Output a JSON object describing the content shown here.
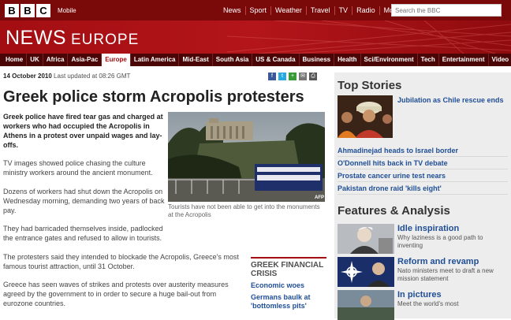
{
  "header": {
    "logo_letters": [
      "B",
      "B",
      "C"
    ],
    "mobile_label": "Mobile",
    "nav": [
      "News",
      "Sport",
      "Weather",
      "Travel",
      "TV",
      "Radio",
      "More ▾"
    ],
    "search_placeholder": "Search the BBC"
  },
  "masthead": {
    "title": "NEWS",
    "section": "EUROPE"
  },
  "sections": [
    "Home",
    "UK",
    "Africa",
    "Asia-Pac",
    "Europe",
    "Latin America",
    "Mid-East",
    "South Asia",
    "US & Canada",
    "Business",
    "Health",
    "Sci/Environment",
    "Tech",
    "Entertainment",
    "Video"
  ],
  "active_section": "Europe",
  "article": {
    "date": "14 October 2010",
    "updated": "Last updated at 08:26 GMT",
    "headline": "Greek police storm Acropolis protesters",
    "intro": "Greek police have fired tear gas and charged at workers who had occupied the Acropolis in Athens in a protest over unpaid wages and lay-offs.",
    "p1": "TV images showed police chasing the culture ministry workers around the ancient monument.",
    "p2": "Dozens of workers had shut down the Acropolis on Wednesday morning, demanding two years of back pay.",
    "p3": "They had barricaded themselves inside, padlocked the entrance gates and refused to allow in tourists.",
    "p4": "The protesters said they intended to blockade the Acropolis, Greece's most famous tourist attraction, until 31 October.",
    "p5": "Greece has seen waves of strikes and protests over austerity measures agreed by the government to in order to secure a huge bail-out from eurozone countries.",
    "caption": "Tourists have not been able to get into the monuments at the Acropolis",
    "photo_credit": "AFP"
  },
  "crisis_box": {
    "title": "GREEK FINANCIAL CRISIS",
    "links": [
      "Economic woes",
      "Germans baulk at 'bottomless pits'"
    ]
  },
  "sidebar": {
    "top_stories_title": "Top Stories",
    "top_story": "Jubilation as Chile rescue ends",
    "stories": [
      "Ahmadinejad heads to Israel border",
      "O'Donnell hits back in TV debate",
      "Prostate cancer urine test nears",
      "Pakistan drone raid 'kills eight'"
    ],
    "features_title": "Features & Analysis",
    "features": [
      {
        "title": "Idle inspiration",
        "desc": "Why laziness is a good path to inventing"
      },
      {
        "title": "Reform and revamp",
        "desc": "Nato ministers meet to draft a new mission statement"
      },
      {
        "title": "In pictures",
        "desc": "Meet the world's most"
      }
    ]
  },
  "colors": {
    "brand_red": "#a30e12",
    "link_blue": "#1f4e96"
  }
}
